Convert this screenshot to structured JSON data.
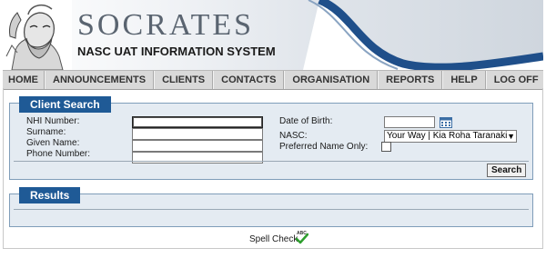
{
  "header": {
    "title": "SOCRATES",
    "subtitle_prefix": "NASC ",
    "subtitle_uat": "UAT",
    "subtitle_suffix": " INFORMATION SYSTEM",
    "logo_icon": "socrates-statue-icon"
  },
  "nav": {
    "items": [
      {
        "label": "HOME"
      },
      {
        "label": "ANNOUNCEMENTS"
      },
      {
        "label": "CLIENTS"
      },
      {
        "label": "CONTACTS"
      },
      {
        "label": "ORGANISATION"
      },
      {
        "label": "REPORTS"
      },
      {
        "label": "HELP"
      },
      {
        "label": "LOG OFF"
      }
    ]
  },
  "client_search": {
    "title": "Client Search",
    "nhi_label": "NHI Number:",
    "nhi_value": "",
    "surname_label": "Surname:",
    "surname_value": "",
    "given_label": "Given Name:",
    "given_value": "",
    "phone_label": "Phone Number:",
    "phone_value": "",
    "dob_label": "Date of Birth:",
    "dob_value": "",
    "calendar_icon": "calendar-icon",
    "nasc_label": "NASC:",
    "nasc_selected": "Your Way | Kia Roha Taranaki",
    "preferred_label": "Preferred Name Only:",
    "preferred_checked": false,
    "search_button": "Search"
  },
  "results": {
    "title": "Results"
  },
  "footer": {
    "spell_check_label": "Spell Check",
    "spell_check_icon": "abc-checkmark-icon"
  },
  "colors": {
    "accent": "#1f5a96",
    "panel_bg": "#e4ebf2",
    "nav_bg": "#d9d9d9"
  }
}
